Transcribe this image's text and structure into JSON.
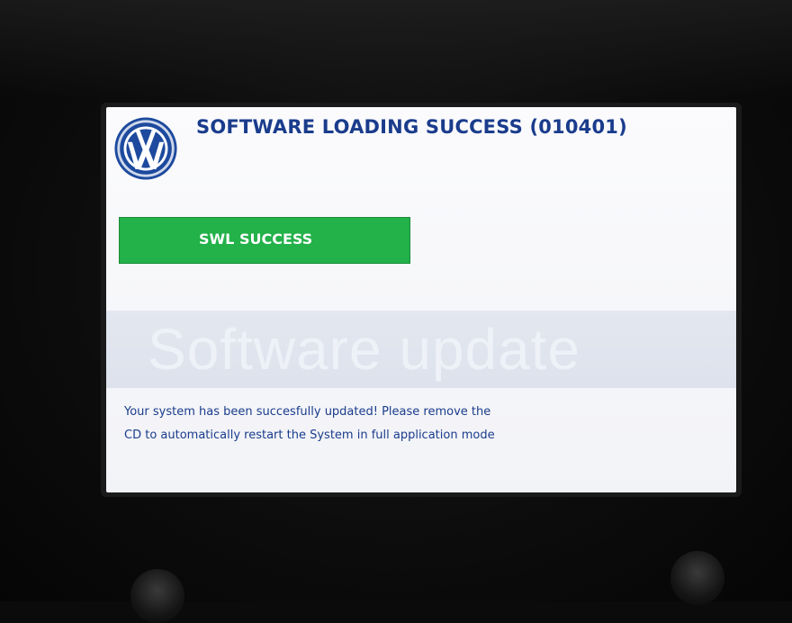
{
  "screen": {
    "title": "SOFTWARE LOADING SUCCESS (010401)",
    "logo_icon": "vw-logo-icon",
    "status": {
      "label": "SWL SUCCESS",
      "color": "#23b14a"
    },
    "watermark": "Software update",
    "message_lines": [
      "Your system has been succesfully updated! Please remove the",
      "CD to automatically restart the System in full application mode"
    ]
  },
  "colors": {
    "title_blue": "#1a3c8c",
    "background": "#fbfbfd"
  }
}
